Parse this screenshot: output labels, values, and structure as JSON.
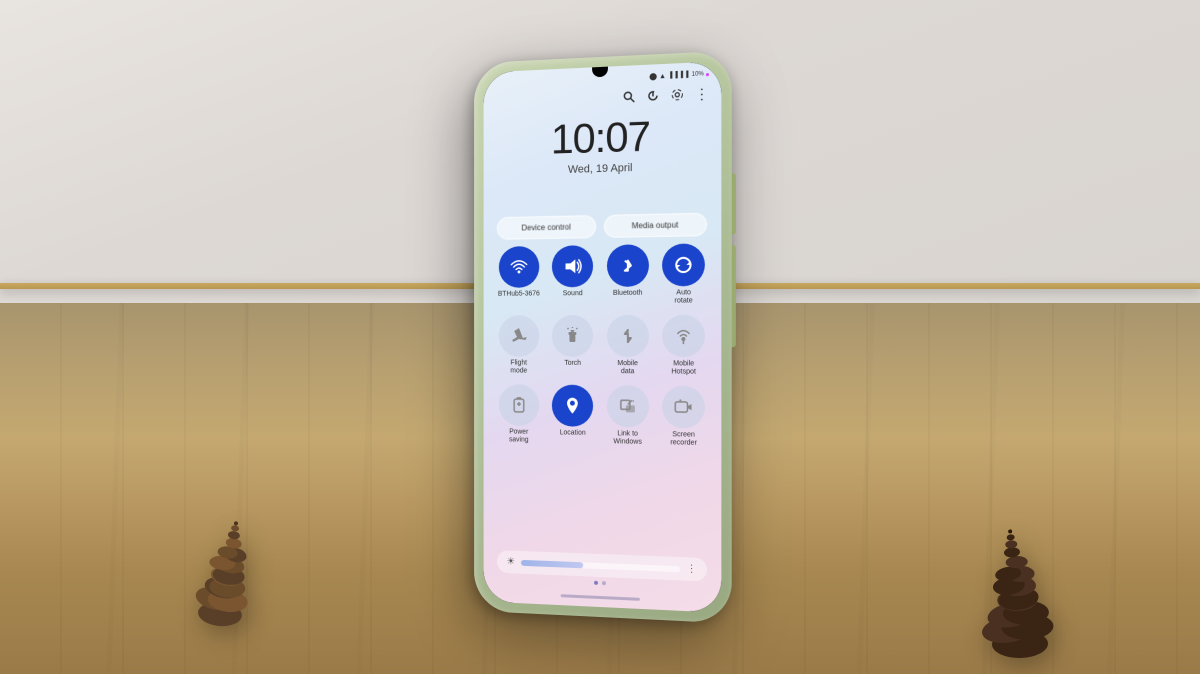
{
  "scene": {
    "background_type": "wooden_desk_with_pine_cones"
  },
  "phone": {
    "status_bar": {
      "bluetooth_icon": "⬤",
      "wifi_icon": "wifi",
      "signal_bars": "signal",
      "battery_percent": "10%",
      "battery_dot_color": "#e040fb"
    },
    "top_actions": [
      {
        "name": "search",
        "icon": "🔍"
      },
      {
        "name": "power",
        "icon": "⏻"
      },
      {
        "name": "settings",
        "icon": "⚙"
      },
      {
        "name": "more",
        "icon": "⋮"
      }
    ],
    "clock": {
      "time": "10:07",
      "date": "Wed, 19 April"
    },
    "quick_buttons": [
      {
        "label": "Device control",
        "active": false
      },
      {
        "label": "Media output",
        "active": false
      }
    ],
    "quick_settings": {
      "row1": [
        {
          "label": "BTHub5-3676",
          "icon": "wifi",
          "active": true
        },
        {
          "label": "Sound",
          "icon": "sound",
          "active": true
        },
        {
          "label": "Bluetooth",
          "icon": "bluetooth",
          "active": true
        },
        {
          "label": "Auto rotate",
          "icon": "rotate",
          "active": true
        }
      ],
      "row2": [
        {
          "label": "Flight mode",
          "icon": "plane",
          "active": false
        },
        {
          "label": "Torch",
          "icon": "torch",
          "active": false
        },
        {
          "label": "Mobile data",
          "icon": "data",
          "active": false
        },
        {
          "label": "Mobile Hotspot",
          "icon": "hotspot",
          "active": false
        }
      ],
      "row3": [
        {
          "label": "Power saving",
          "icon": "power",
          "active": false
        },
        {
          "label": "Location",
          "icon": "location",
          "active": true
        },
        {
          "label": "Link to Windows",
          "icon": "link",
          "active": false
        },
        {
          "label": "Screen recorder",
          "icon": "record",
          "active": false
        }
      ]
    },
    "brightness": {
      "level": 40,
      "icon": "☀"
    },
    "page_dots": [
      {
        "active": true
      },
      {
        "active": false
      }
    ]
  }
}
